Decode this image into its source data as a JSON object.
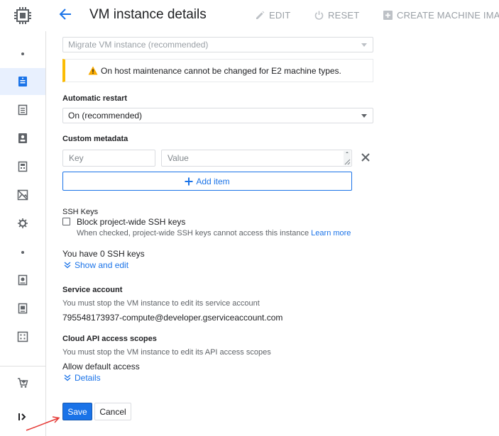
{
  "header": {
    "title": "VM instance details",
    "actions": {
      "edit": "EDIT",
      "reset": "RESET",
      "create_image": "CREATE MACHINE IMAG"
    }
  },
  "form": {
    "on_host_maintenance": {
      "value": "Migrate VM instance (recommended)"
    },
    "warning": "On host maintenance cannot be changed for E2 machine types.",
    "automatic_restart": {
      "label": "Automatic restart",
      "value": "On (recommended)"
    },
    "custom_metadata": {
      "label": "Custom metadata",
      "key_placeholder": "Key",
      "value_placeholder": "Value",
      "add_item": "Add item"
    },
    "ssh_keys": {
      "label": "SSH Keys",
      "block_label": "Block project-wide SSH keys",
      "block_help": "When checked, project-wide SSH keys cannot access this instance",
      "learn_more": "Learn more",
      "count_text": "You have 0 SSH keys",
      "show_edit": "Show and edit"
    },
    "service_account": {
      "label": "Service account",
      "help": "You must stop the VM instance to edit its service account",
      "value": "795548173937-compute@developer.gserviceaccount.com"
    },
    "api_scopes": {
      "label": "Cloud API access scopes",
      "help": "You must stop the VM instance to edit its API access scopes",
      "value": "Allow default access",
      "details": "Details"
    }
  },
  "footer": {
    "save": "Save",
    "cancel": "Cancel"
  },
  "colors": {
    "accent": "#1a73e8",
    "warning": "#fbbc04"
  }
}
